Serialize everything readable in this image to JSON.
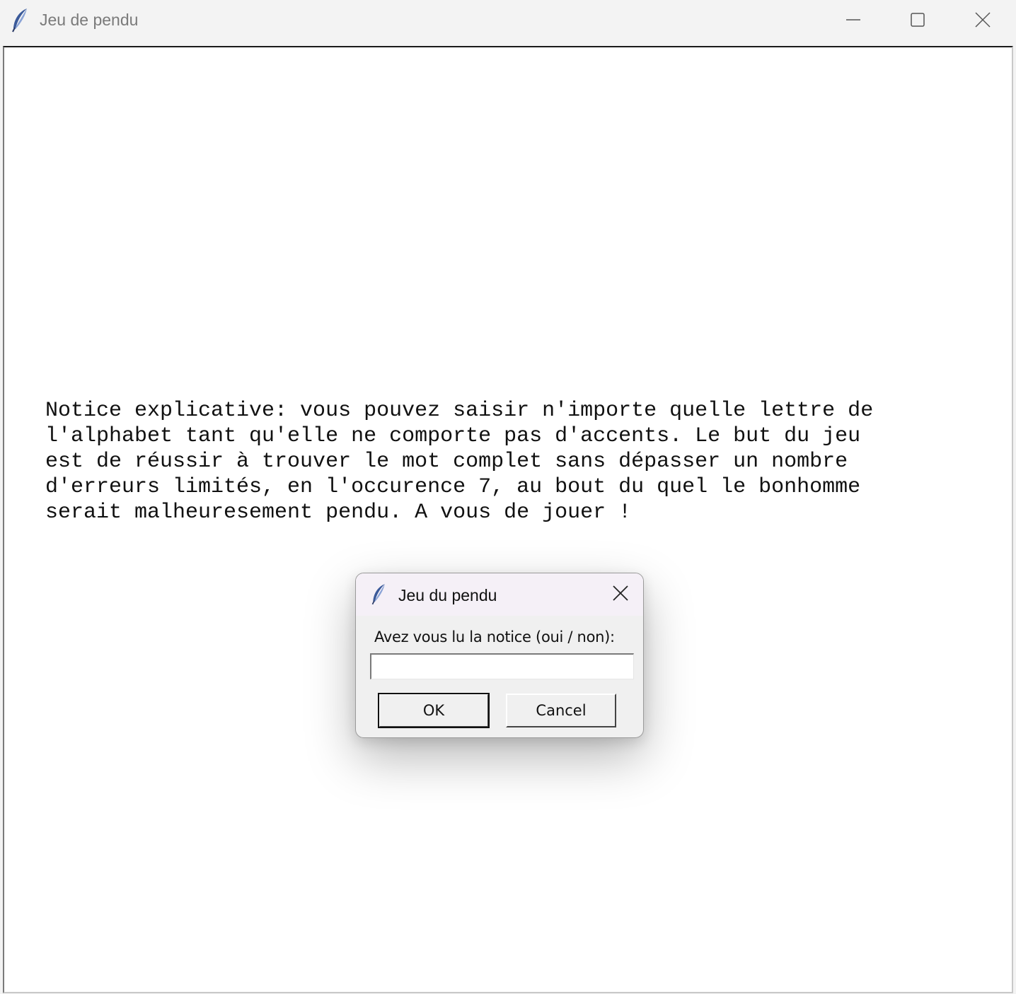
{
  "window": {
    "title": "Jeu de pendu",
    "icons": {
      "app": "feather-icon",
      "minimize": "minimize-icon",
      "maximize": "maximize-icon",
      "close": "close-icon"
    }
  },
  "main": {
    "notice": "Notice explicative: vous pouvez saisir n'importe quelle lettre de\nl'alphabet tant qu'elle ne comporte pas d'accents. Le but du jeu\nest de réussir à trouver le mot complet sans dépasser un nombre\nd'erreurs limités, en l'occurence 7, au bout du quel le bonhomme\nserait malheuresement pendu. A vous de jouer !"
  },
  "dialog": {
    "title": "Jeu du pendu",
    "prompt": "Avez vous lu la notice (oui / non):",
    "input_value": "",
    "ok_label": "OK",
    "cancel_label": "Cancel"
  },
  "colors": {
    "titlebar_bg": "#f3f3f3",
    "client_bg": "#ffffff",
    "dialog_bg": "#f0f0f0",
    "dialog_titlebar_bg": "#f5f0f7"
  }
}
